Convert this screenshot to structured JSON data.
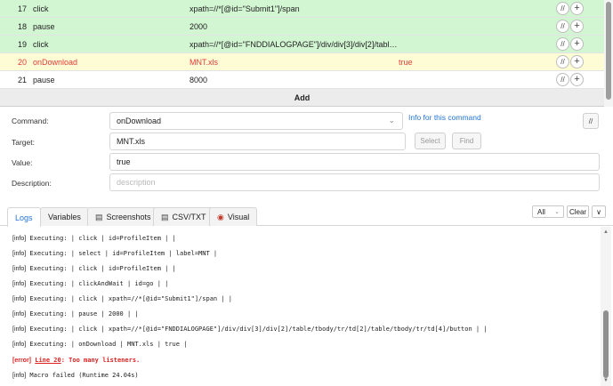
{
  "commands": [
    {
      "num": "17",
      "command": "click",
      "target": "xpath=//*[@id=\"Submit1\"]/span",
      "value": "",
      "state": "green"
    },
    {
      "num": "18",
      "command": "pause",
      "target": "2000",
      "value": "",
      "state": "green"
    },
    {
      "num": "19",
      "command": "click",
      "target": "xpath=//*[@id=\"FNDDIALOGPAGE\"]/div/div[3]/div[2]/table/tbody/...",
      "value": "",
      "state": "green"
    },
    {
      "num": "20",
      "command": "onDownload",
      "target": "MNT.xls",
      "value": "true",
      "state": "yellow"
    },
    {
      "num": "21",
      "command": "pause",
      "target": "8000",
      "value": "",
      "state": "white"
    }
  ],
  "row_buttons": {
    "comment": "//",
    "add": "+"
  },
  "add_label": "Add",
  "form": {
    "command_label": "Command:",
    "command_value": "onDownload",
    "info_link": "Info for this command",
    "comment_toggle": "//",
    "target_label": "Target:",
    "target_value": "MNT.xls",
    "select_label": "Select",
    "find_label": "Find",
    "value_label": "Value:",
    "value_value": "true",
    "description_label": "Description:",
    "description_placeholder": "description"
  },
  "tabs": {
    "logs": "Logs",
    "variables": "Variables",
    "screenshots": "Screenshots",
    "csv": "CSV/TXT",
    "visual": "Visual"
  },
  "log_controls": {
    "filter": "All",
    "clear": "Clear",
    "toggle": "∨"
  },
  "log_lines": [
    {
      "level": "[info]",
      "text": "Executing:  | click | id=ProfileItem |  |"
    },
    {
      "level": "[info]",
      "text": "Executing:  | select | id=ProfileItem | label=MNT |"
    },
    {
      "level": "[info]",
      "text": "Executing:  | click | id=ProfileItem |  |"
    },
    {
      "level": "[info]",
      "text": "Executing:  | clickAndWait | id=go |  |"
    },
    {
      "level": "[info]",
      "text": "Executing:  | click | xpath=//*[@id=\"Submit1\"]/span |  |"
    },
    {
      "level": "[info]",
      "text": "Executing:  | pause | 2000 |  |"
    },
    {
      "level": "[info]",
      "text": "Executing:  | click | xpath=//*[@id=\"FNDDIALOGPAGE\"]/div/div[3]/div[2]/table/tbody/tr/td[2]/table/tbody/tr/td[4]/button |  |"
    },
    {
      "level": "[info]",
      "text": "Executing:  | onDownload | MNT.xls | true |"
    }
  ],
  "error_line": {
    "level": "[error]",
    "link": "Line 20",
    "text": ": Too many listeners."
  },
  "final_line": {
    "level": "[info]",
    "text": "Macro failed (Runtime 24.04s)"
  },
  "icons": {
    "comment": "comment-toggle-icon",
    "add": "plus-icon",
    "dropdown": "chevron-down-icon",
    "screenshots": "camera-icon",
    "csv": "file-icon",
    "visual": "eye-icon"
  },
  "colors": {
    "executed_row": "#d2f5d2",
    "error_row": "#fdfcd4",
    "error_text": "#e23b3b",
    "accent": "#2474d6"
  }
}
